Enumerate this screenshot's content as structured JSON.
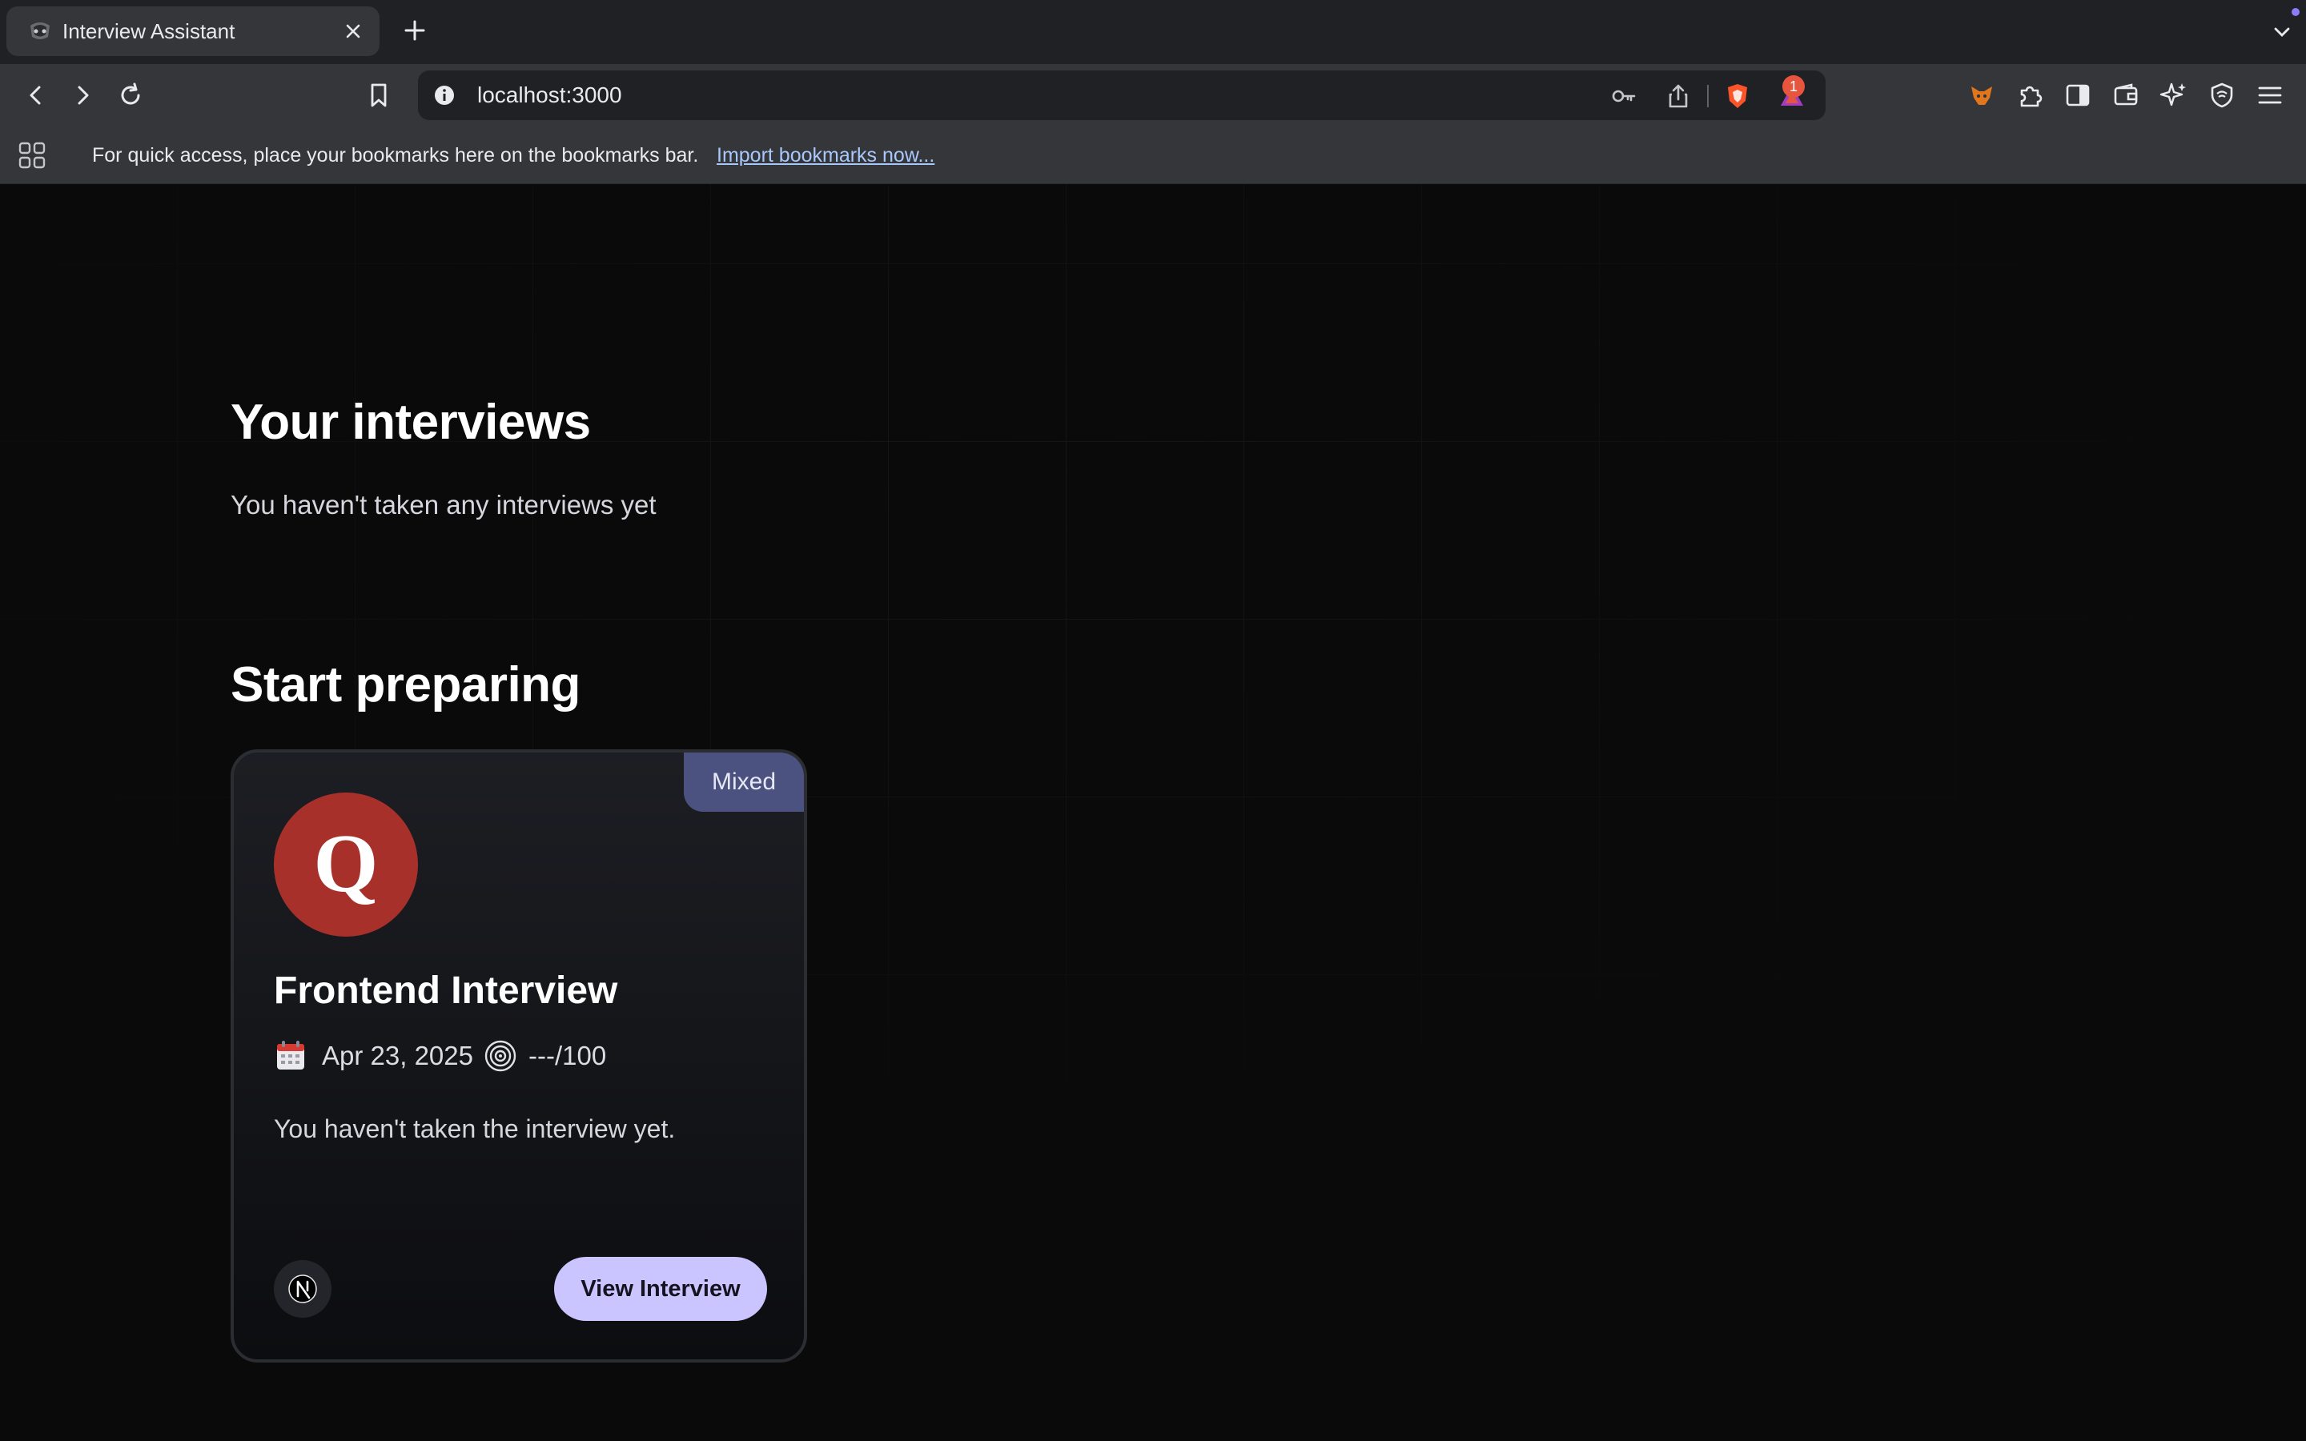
{
  "browser": {
    "tab_title": "Interview Assistant",
    "url": "localhost:3000",
    "notification_count": "1",
    "bookmarks_bar_text": "For quick access, place your bookmarks here on the bookmarks bar.",
    "bookmarks_import_link": "Import bookmarks now..."
  },
  "page": {
    "section_interviews": {
      "heading": "Your interviews",
      "empty_text": "You haven't taken any interviews yet"
    },
    "section_prepare": {
      "heading": "Start preparing",
      "cards": [
        {
          "badge": "Mixed",
          "title": "Frontend Interview",
          "date": "Apr 23, 2025",
          "score": "---/100",
          "description": "You haven't taken the interview yet.",
          "button_label": "View Interview",
          "logo_letter": "Q",
          "logo_icon": "quora-logo-icon",
          "tech_icon": "nextjs-icon"
        }
      ]
    }
  },
  "colors": {
    "background": "#0a0a0b",
    "badge": "#4c5280",
    "button": "#cac5fe",
    "logo": "#a8302b"
  }
}
